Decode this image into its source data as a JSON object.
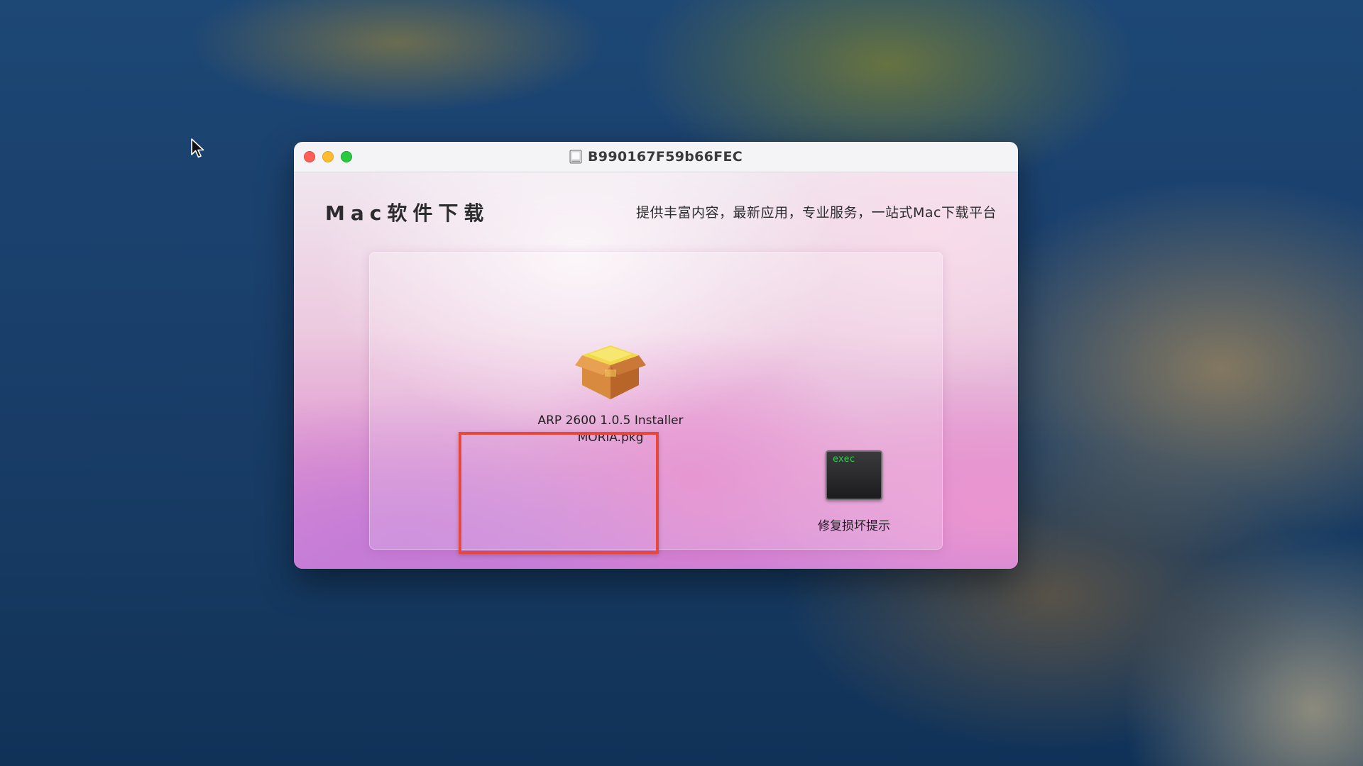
{
  "window": {
    "title": "B990167F59b66FEC",
    "disk_icon": "disk-image-icon"
  },
  "content": {
    "heading": "Mac软件下载",
    "tagline": "提供丰富内容，最新应用，专业服务，一站式Mac下载平台"
  },
  "files": [
    {
      "label": "ARP 2600 1.0.5 Installer MORiA.pkg",
      "icon": "package-icon",
      "highlighted": true,
      "highlight_color": "#e8473c"
    },
    {
      "label": "修复损坏提示",
      "icon": "exec-terminal-icon",
      "icon_text": "exec"
    }
  ],
  "colors": {
    "traffic_red": "#fe5f57",
    "traffic_yellow": "#febc2e",
    "traffic_green": "#28c840"
  }
}
